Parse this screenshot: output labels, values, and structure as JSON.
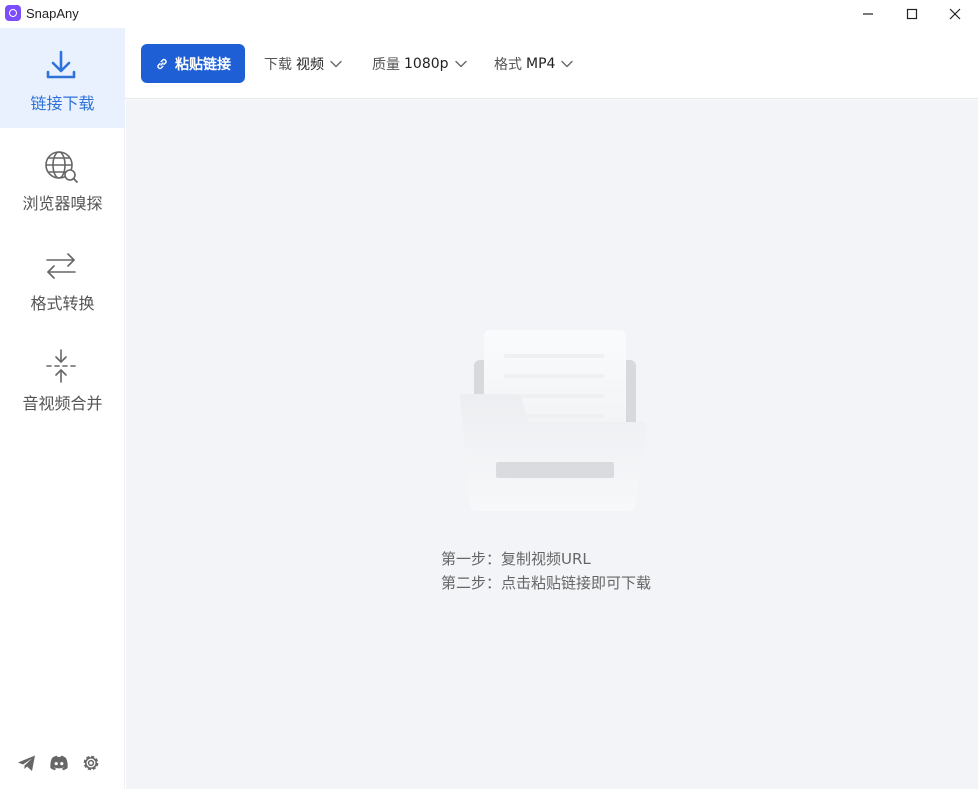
{
  "window": {
    "title": "SnapAny",
    "controls": [
      "minimize",
      "maximize",
      "close"
    ]
  },
  "sidebar": {
    "items": [
      {
        "label": "链接下载",
        "icon": "download-icon",
        "active": true
      },
      {
        "label": "浏览器嗅探",
        "icon": "globe-search-icon",
        "active": false
      },
      {
        "label": "格式转换",
        "icon": "swap-arrows-icon",
        "active": false
      },
      {
        "label": "音视频合并",
        "icon": "merge-icon",
        "active": false
      }
    ],
    "footer_icons": [
      "telegram-icon",
      "discord-icon",
      "settings-icon"
    ]
  },
  "toolbar": {
    "paste_label": "粘贴链接",
    "download": {
      "label": "下载",
      "value": "视频"
    },
    "quality": {
      "label": "质量",
      "value": "1080p"
    },
    "format": {
      "label": "格式",
      "value": "MP4"
    }
  },
  "main": {
    "empty_illustration": "empty-folder-illustration",
    "hint_1": "第一步：复制视频URL",
    "hint_2": "第二步：点击粘贴链接即可下载"
  },
  "colors": {
    "accent": "#1f5fd6",
    "active_nav_bg": "#e8f1fd",
    "active_nav_text": "#2f73d9",
    "main_bg": "#f2f4f7"
  }
}
